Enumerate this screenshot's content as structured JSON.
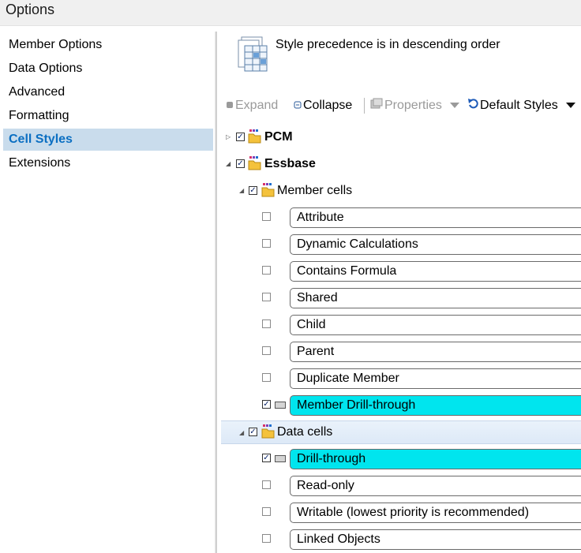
{
  "window": {
    "title": "Options"
  },
  "nav": {
    "items": [
      {
        "label": "Member Options",
        "selected": false
      },
      {
        "label": "Data Options",
        "selected": false
      },
      {
        "label": "Advanced",
        "selected": false
      },
      {
        "label": "Formatting",
        "selected": false
      },
      {
        "label": "Cell Styles",
        "selected": true
      },
      {
        "label": "Extensions",
        "selected": false
      }
    ]
  },
  "header": {
    "text": "Style precedence is in descending order"
  },
  "toolbar": {
    "expand": "Expand",
    "collapse": "Collapse",
    "properties": "Properties",
    "default_styles": "Default Styles"
  },
  "tree": {
    "pcm": {
      "label": "PCM",
      "checked": true
    },
    "essbase": {
      "label": "Essbase",
      "checked": true
    },
    "member_cells": {
      "label": "Member cells",
      "checked": true
    },
    "member_items": [
      {
        "label": "Attribute",
        "checked": false
      },
      {
        "label": "Dynamic Calculations",
        "checked": false
      },
      {
        "label": "Contains Formula",
        "checked": false
      },
      {
        "label": "Shared",
        "checked": false
      },
      {
        "label": "Child",
        "checked": false
      },
      {
        "label": "Parent",
        "checked": false
      },
      {
        "label": "Duplicate Member",
        "checked": false
      },
      {
        "label": "Member Drill-through",
        "checked": true
      }
    ],
    "data_cells": {
      "label": "Data cells",
      "checked": true
    },
    "data_items": [
      {
        "label": "Drill-through",
        "checked": true
      },
      {
        "label": "Read-only",
        "checked": false
      },
      {
        "label": "Writable (lowest priority is recommended)",
        "checked": false
      },
      {
        "label": "Linked Objects",
        "checked": false
      }
    ]
  },
  "colors": {
    "highlight_style": "#00e5ee",
    "nav_selected_bg": "#c9dcec",
    "nav_selected_text": "#0b6fc2"
  }
}
